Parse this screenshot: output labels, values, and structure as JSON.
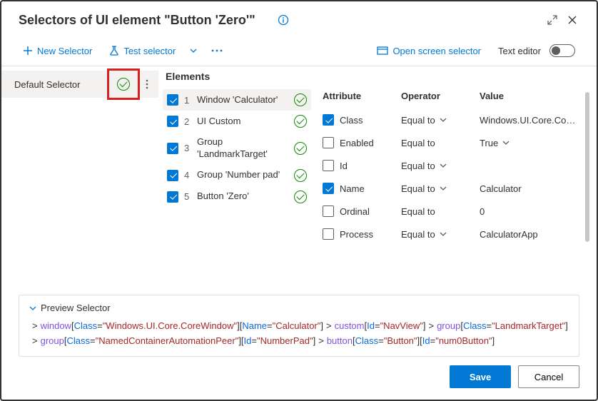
{
  "title": "Selectors of UI element \"Button 'Zero'\"",
  "toolbar": {
    "newSelector": "New Selector",
    "testSelector": "Test selector",
    "openScreen": "Open screen selector",
    "textEditor": "Text editor"
  },
  "selectors": [
    {
      "name": "Default Selector",
      "valid": true
    }
  ],
  "elementsHeading": "Elements",
  "elements": [
    {
      "checked": true,
      "idx": "1",
      "label": "Window 'Calculator'",
      "valid": true,
      "selected": true
    },
    {
      "checked": true,
      "idx": "2",
      "label": "UI Custom",
      "valid": true
    },
    {
      "checked": true,
      "idx": "3",
      "label": "Group 'LandmarkTarget'",
      "valid": true
    },
    {
      "checked": true,
      "idx": "4",
      "label": "Group 'Number pad'",
      "valid": true
    },
    {
      "checked": true,
      "idx": "5",
      "label": "Button 'Zero'",
      "valid": true
    }
  ],
  "attrHeader": {
    "attribute": "Attribute",
    "operator": "Operator",
    "value": "Value"
  },
  "attributes": [
    {
      "checked": true,
      "name": "Class",
      "op": "Equal to",
      "opChev": true,
      "value": "Windows.UI.Core.CoreWindow"
    },
    {
      "checked": false,
      "name": "Enabled",
      "op": "Equal to",
      "opChev": false,
      "value": "True",
      "valChev": true
    },
    {
      "checked": false,
      "name": "Id",
      "op": "Equal to",
      "opChev": true,
      "value": ""
    },
    {
      "checked": true,
      "name": "Name",
      "op": "Equal to",
      "opChev": true,
      "value": "Calculator"
    },
    {
      "checked": false,
      "name": "Ordinal",
      "op": "Equal to",
      "opChev": false,
      "value": "0"
    },
    {
      "checked": false,
      "name": "Process",
      "op": "Equal to",
      "opChev": true,
      "value": "CalculatorApp"
    }
  ],
  "preview": {
    "label": "Preview Selector",
    "parts": [
      {
        "gt": true
      },
      {
        "tag": "window"
      },
      {
        "br": "["
      },
      {
        "attr": "Class"
      },
      {
        "br": "="
      },
      {
        "str": "\"Windows.UI.Core.CoreWindow\""
      },
      {
        "br": "]["
      },
      {
        "attr": "Name"
      },
      {
        "br": "="
      },
      {
        "str": "\"Calculator\""
      },
      {
        "br": "]"
      },
      {
        "gt": true
      },
      {
        "tag": "custom"
      },
      {
        "br": "["
      },
      {
        "attr": "Id"
      },
      {
        "br": "="
      },
      {
        "str": "\"NavView\""
      },
      {
        "br": "]"
      },
      {
        "gt": true
      },
      {
        "tag": "group"
      },
      {
        "br": "["
      },
      {
        "attr": "Class"
      },
      {
        "br": "="
      },
      {
        "str": "\"LandmarkTarget\""
      },
      {
        "br": "]"
      },
      {
        "nl": true
      },
      {
        "gt": true
      },
      {
        "tag": "group"
      },
      {
        "br": "["
      },
      {
        "attr": "Class"
      },
      {
        "br": "="
      },
      {
        "str": "\"NamedContainerAutomationPeer\""
      },
      {
        "br": "]["
      },
      {
        "attr": "Id"
      },
      {
        "br": "="
      },
      {
        "str": "\"NumberPad\""
      },
      {
        "br": "]"
      },
      {
        "gt": true
      },
      {
        "tag": "button"
      },
      {
        "br": "["
      },
      {
        "attr": "Class"
      },
      {
        "br": "="
      },
      {
        "str": "\"Button\""
      },
      {
        "br": "]["
      },
      {
        "attr": "Id"
      },
      {
        "br": "="
      },
      {
        "str": "\"num0Button\""
      },
      {
        "br": "]"
      }
    ]
  },
  "footer": {
    "save": "Save",
    "cancel": "Cancel"
  }
}
